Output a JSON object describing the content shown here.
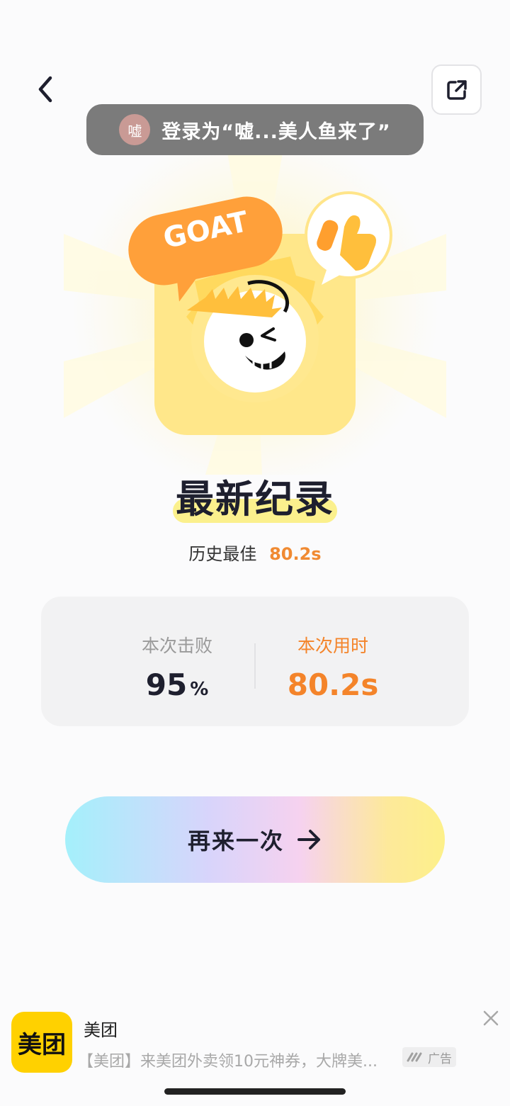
{
  "toast": {
    "avatar_char": "嘘",
    "text": "登录为“嘘...美人鱼来了”"
  },
  "hero": {
    "badge_text": "GOAT"
  },
  "record": {
    "title": "最新纪录",
    "best_label": "历史最佳",
    "best_value": "80.2s"
  },
  "stats": {
    "defeated_label": "本次击败",
    "defeated_value": "95",
    "defeated_unit": "%",
    "time_label": "本次用时",
    "time_value": "80.2s"
  },
  "actions": {
    "again_label": "再来一次"
  },
  "ad": {
    "logo_text": "美团",
    "title": "美团",
    "description": "【美团】来美团外卖领10元神券，大牌美...",
    "badge_label": "广告"
  },
  "icons": {
    "back": "chevron-left-icon",
    "share": "external-link-icon",
    "arrow": "arrow-right-icon",
    "close": "close-icon",
    "ad_brand": "ad-brand-icon"
  },
  "colors": {
    "accent_orange": "#f4842a",
    "ad_yellow": "#ffd100",
    "title_dark": "#1e1f2e"
  }
}
